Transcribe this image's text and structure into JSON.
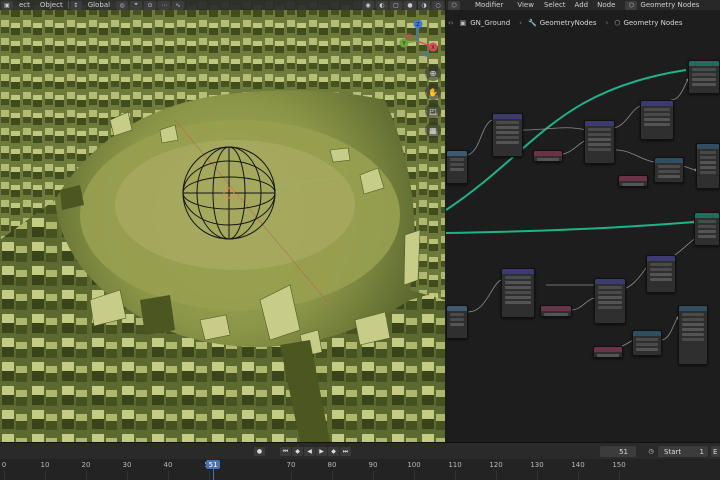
{
  "viewport": {
    "header": {
      "object_menu": "Object",
      "orientation": "Global",
      "partial_left": "ect"
    },
    "gizmo": {
      "x": "X",
      "y": "Y",
      "z": "Z"
    }
  },
  "node_editor": {
    "menubar": {
      "modifier": "Modifier",
      "view": "View",
      "select": "Select",
      "add": "Add",
      "node": "Node",
      "tree_name": "Geometry Nodes"
    },
    "breadcrumb": [
      "GN_Ground",
      "GeometryNodes",
      "Geometry Nodes"
    ],
    "wire_color_geometry": "#1fb38a",
    "wire_color_data": "#8c8c8c",
    "header_colors": {
      "vector": "#3b3b70",
      "float": "#6a3347",
      "geometry": "#1f6e5e",
      "input": "#3d5a73",
      "utility": "#2f4f60"
    }
  },
  "timeline": {
    "current_frame": "51",
    "start_label": "Start",
    "start_value": "1",
    "end_partial": "E",
    "ruler": [
      "0",
      "10",
      "20",
      "30",
      "40",
      "50",
      "70",
      "80",
      "90",
      "100",
      "110",
      "120",
      "130",
      "140",
      "150"
    ],
    "playhead_value": 51
  }
}
